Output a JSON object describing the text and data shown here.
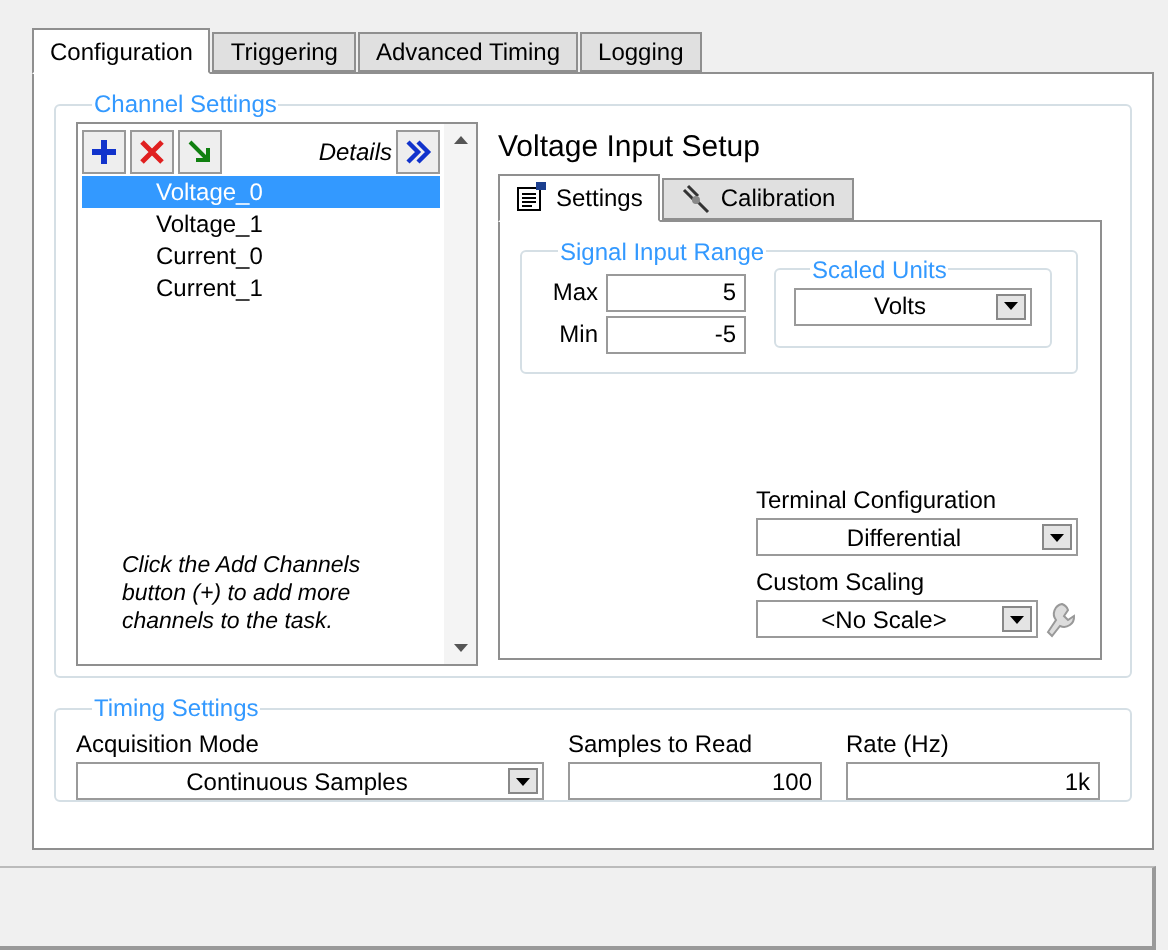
{
  "tabs": [
    {
      "label": "Configuration",
      "selected": true
    },
    {
      "label": "Triggering",
      "selected": false
    },
    {
      "label": "Advanced Timing",
      "selected": false
    },
    {
      "label": "Logging",
      "selected": false
    }
  ],
  "channel_settings": {
    "title": "Channel Settings",
    "details_label": "Details",
    "channels": [
      {
        "name": "Voltage_0",
        "selected": true
      },
      {
        "name": "Voltage_1",
        "selected": false
      },
      {
        "name": "Current_0",
        "selected": false
      },
      {
        "name": "Current_1",
        "selected": false
      }
    ],
    "hint": "Click the Add Channels button (+) to add more channels to the task."
  },
  "voltage_input_setup": {
    "title": "Voltage Input Setup",
    "tabs": [
      {
        "label": "Settings",
        "selected": true,
        "kind": "settings"
      },
      {
        "label": "Calibration",
        "selected": false,
        "kind": "calibration"
      }
    ],
    "signal_input_range": {
      "title": "Signal Input Range",
      "max": {
        "label": "Max",
        "value": "5"
      },
      "min": {
        "label": "Min",
        "value": "-5"
      }
    },
    "scaled_units": {
      "title": "Scaled Units",
      "value": "Volts"
    },
    "terminal_configuration": {
      "label": "Terminal Configuration",
      "value": "Differential"
    },
    "custom_scaling": {
      "label": "Custom Scaling",
      "value": "<No Scale>"
    }
  },
  "timing_settings": {
    "title": "Timing Settings",
    "acquisition_mode": {
      "label": "Acquisition Mode",
      "value": "Continuous Samples"
    },
    "samples_to_read": {
      "label": "Samples to Read",
      "value": "100"
    },
    "rate": {
      "label": "Rate (Hz)",
      "value": "1k"
    }
  }
}
